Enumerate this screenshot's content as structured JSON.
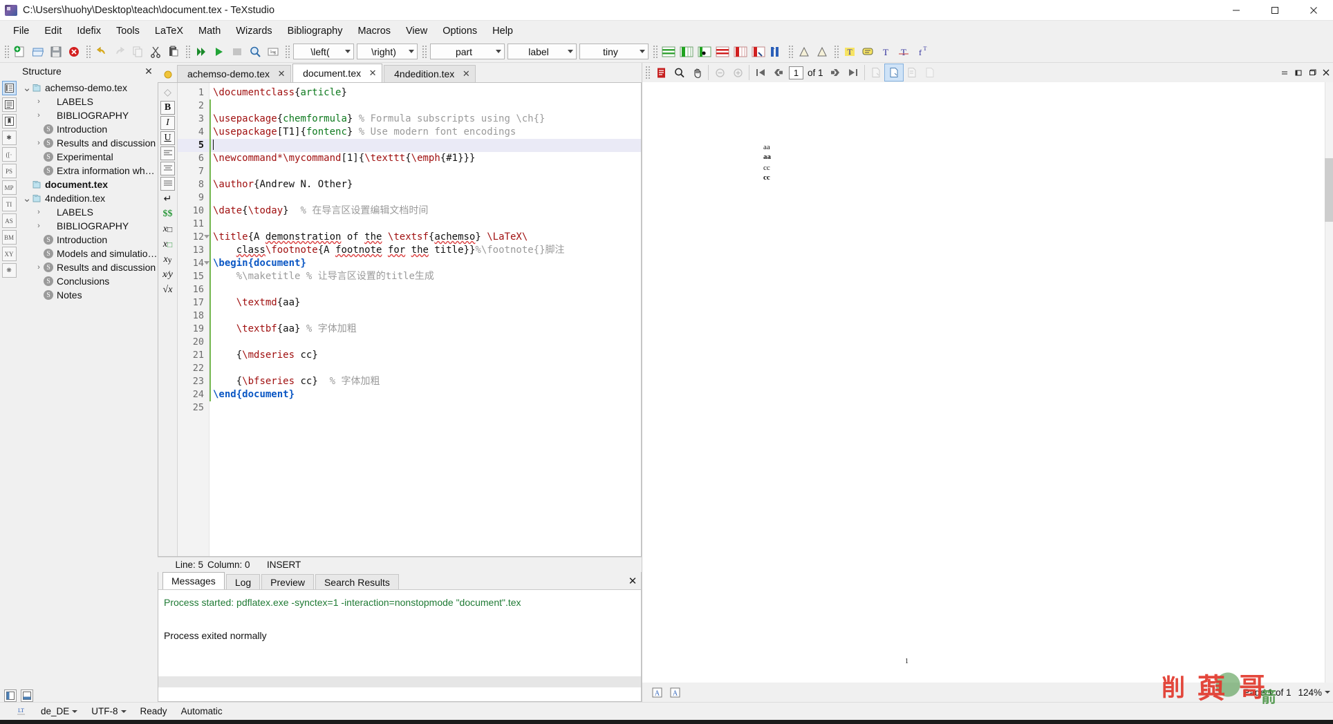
{
  "window": {
    "title": "C:\\Users\\huohy\\Desktop\\teach\\document.tex - TeXstudio",
    "minimize": "—",
    "maximize": "❐",
    "close": "✕"
  },
  "menu": [
    "File",
    "Edit",
    "Idefix",
    "Tools",
    "LaTeX",
    "Math",
    "Wizards",
    "Bibliography",
    "Macros",
    "View",
    "Options",
    "Help"
  ],
  "toolbar": {
    "combos": [
      {
        "name": "left-bracket-combo",
        "value": "\\left("
      },
      {
        "name": "right-bracket-combo",
        "value": "\\right)"
      },
      {
        "name": "section-level-combo",
        "value": "part"
      },
      {
        "name": "label-combo",
        "value": "label"
      },
      {
        "name": "fontsize-combo",
        "value": "tiny"
      }
    ],
    "buttons": [
      "new-document-icon",
      "open-document-icon",
      "save-icon",
      "close-document-icon",
      "undo-icon",
      "redo-icon",
      "copy-icon",
      "cut-icon",
      "paste-icon",
      "build-and-view-icon",
      "run-icon",
      "stop-icon",
      "view-log-icon",
      "log-icon"
    ]
  },
  "rail": {
    "items": [
      "structure-view",
      "outline-view",
      "bookmarks-view",
      "symbols-star",
      "brackets",
      "PS",
      "MP",
      "TI",
      "AS",
      "BM",
      "XY",
      "misc-symbols"
    ]
  },
  "structure": {
    "title": "Structure",
    "close": "✕",
    "tree": [
      {
        "label": "achemso-demo.tex",
        "type": "file",
        "indent": 0,
        "chevron": "v",
        "bold": false
      },
      {
        "label": "LABELS",
        "type": "group",
        "indent": 1,
        "chevron": ">",
        "bold": false
      },
      {
        "label": "BIBLIOGRAPHY",
        "type": "group",
        "indent": 1,
        "chevron": ">",
        "bold": false
      },
      {
        "label": "Introduction",
        "type": "section",
        "indent": 1,
        "chevron": "",
        "bold": false
      },
      {
        "label": "Results and discussion",
        "type": "section",
        "indent": 1,
        "chevron": ">",
        "bold": false
      },
      {
        "label": "Experimental",
        "type": "section",
        "indent": 1,
        "chevron": "",
        "bold": false
      },
      {
        "label": "Extra information when writin...",
        "type": "section",
        "indent": 1,
        "chevron": "",
        "bold": false
      },
      {
        "label": "document.tex",
        "type": "file",
        "indent": 0,
        "chevron": "",
        "bold": true
      },
      {
        "label": "4ndedition.tex",
        "type": "file",
        "indent": 0,
        "chevron": "v",
        "bold": false
      },
      {
        "label": "LABELS",
        "type": "group",
        "indent": 1,
        "chevron": ">",
        "bold": false
      },
      {
        "label": "BIBLIOGRAPHY",
        "type": "group",
        "indent": 1,
        "chevron": ">",
        "bold": false
      },
      {
        "label": "Introduction",
        "type": "section",
        "indent": 1,
        "chevron": "",
        "bold": false
      },
      {
        "label": "Models and simulation metho...",
        "type": "section",
        "indent": 1,
        "chevron": "",
        "bold": false
      },
      {
        "label": "Results and discussion",
        "type": "section",
        "indent": 1,
        "chevron": ">",
        "bold": false
      },
      {
        "label": "Conclusions",
        "type": "section",
        "indent": 1,
        "chevron": "",
        "bold": false
      },
      {
        "label": "Notes",
        "type": "section",
        "indent": 1,
        "chevron": "",
        "bold": false
      }
    ]
  },
  "editor": {
    "tabs": [
      {
        "label": "achemso-demo.tex",
        "active": false,
        "close": "✕"
      },
      {
        "label": "document.tex",
        "active": true,
        "close": "✕"
      },
      {
        "label": "4ndedition.tex",
        "active": false,
        "close": "✕"
      }
    ],
    "format_rail": [
      "B",
      "I",
      "U",
      "align-left-icon",
      "align-center-icon",
      "align-justify-icon",
      "newline-icon",
      "$$",
      "subscript-icon",
      "superscript-icon",
      "subsup-icon",
      "frac-icon",
      "sqrt-icon"
    ],
    "cursor_line": 5,
    "lines": [
      {
        "n": 1,
        "text": "\\documentclass{article}"
      },
      {
        "n": 2,
        "text": ""
      },
      {
        "n": 3,
        "text": "\\usepackage{chemformula} % Formula subscripts using \\ch{}"
      },
      {
        "n": 4,
        "text": "\\usepackage[T1]{fontenc} % Use modern font encodings"
      },
      {
        "n": 5,
        "text": ""
      },
      {
        "n": 6,
        "text": "\\newcommand*\\mycommand[1]{\\texttt{\\emph{#1}}}"
      },
      {
        "n": 7,
        "text": ""
      },
      {
        "n": 8,
        "text": "\\author{Andrew N. Other}"
      },
      {
        "n": 9,
        "text": ""
      },
      {
        "n": 10,
        "text": "\\date{\\today}  % 在导言区设置编辑文档时间"
      },
      {
        "n": 11,
        "text": ""
      },
      {
        "n": 12,
        "text": "\\title{A demonstration of the \\textsf{achemso} \\LaTeX\\"
      },
      {
        "n": 13,
        "text": "    class\\footnote{A footnote for the title}}%\\footnote{}脚注"
      },
      {
        "n": 14,
        "text": "\\begin{document}"
      },
      {
        "n": 15,
        "text": "    %\\maketitle % 让导言区设置的title生成"
      },
      {
        "n": 16,
        "text": ""
      },
      {
        "n": 17,
        "text": "    \\textmd{aa}"
      },
      {
        "n": 18,
        "text": ""
      },
      {
        "n": 19,
        "text": "    \\textbf{aa} % 字体加粗"
      },
      {
        "n": 20,
        "text": ""
      },
      {
        "n": 21,
        "text": "    {\\mdseries cc}"
      },
      {
        "n": 22,
        "text": ""
      },
      {
        "n": 23,
        "text": "    {\\bfseries cc}  % 字体加粗"
      },
      {
        "n": 24,
        "text": "\\end{document}"
      },
      {
        "n": 25,
        "text": ""
      }
    ],
    "status": {
      "line_label": "Line: 5",
      "column_label": "Column: 0",
      "mode": "INSERT"
    }
  },
  "messages": {
    "tabs": [
      "Messages",
      "Log",
      "Preview",
      "Search Results"
    ],
    "active_tab": "Messages",
    "close": "✕",
    "lines": [
      {
        "text": "Process started: pdflatex.exe -synctex=1 -interaction=nonstopmode \"document\".tex",
        "color": "green"
      },
      {
        "text": "",
        "color": "black"
      },
      {
        "text": "Process exited normally",
        "color": "black"
      }
    ]
  },
  "pdf": {
    "toolbar": {
      "open_icon": "pdf-file-icon",
      "magnify_icon": "magnifier-icon",
      "hand_icon": "hand-tool-icon",
      "zoom_out_icon": "zoom-out-icon",
      "zoom_in_icon": "zoom-in-icon",
      "first_page_icon": "first-page-icon",
      "prev_page_icon": "previous-page-icon",
      "page_value": "1",
      "of_label": "of 1",
      "next_page_icon": "next-page-icon",
      "last_page_icon": "last-page-icon",
      "single_page_icon": "single-page-icon",
      "fit_page_icon": "fit-page-icon",
      "continuous_icon": "continuous-page-icon",
      "two_page_icon": "two-page-icon"
    },
    "window_buttons": {
      "minimize": "—",
      "restore": "❐",
      "float": "❑",
      "close": "✕"
    },
    "page_content": [
      "aa",
      "aa",
      "cc",
      "cc"
    ],
    "page_number": "1",
    "page_label": "Page 1 of 1",
    "zoom": "124%",
    "bottom_icons": [
      "text-tool-a-icon",
      "text-tool-b-icon"
    ]
  },
  "statusbar": {
    "lt_label": "LT",
    "language": "de_DE",
    "encoding": "UTF-8",
    "ready": "Ready",
    "autocheck": "Automatic"
  },
  "colors": {
    "command": "#a01010",
    "environment": "#0b57c4",
    "argument": "#0f7a1f",
    "comment": "#9a9a9a",
    "accent": "#76b852",
    "success": "#1f7a34"
  }
}
